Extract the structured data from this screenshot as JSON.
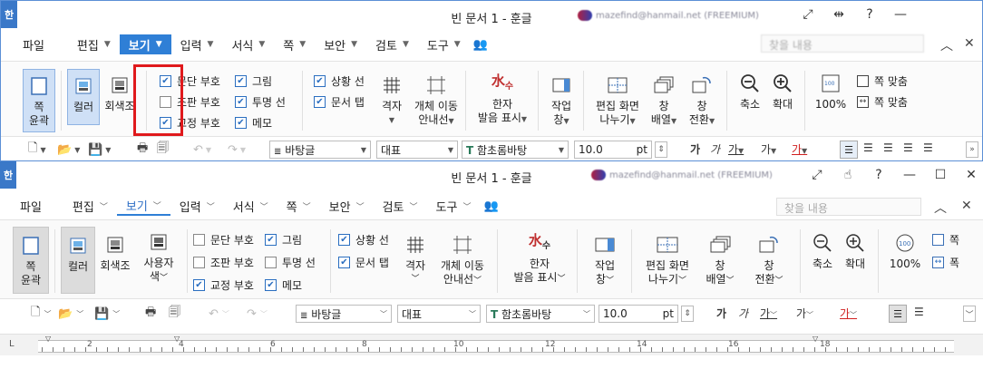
{
  "app": {
    "logo": "한",
    "title": "빈 문서 1 - 훈글",
    "account": "mazefind@hanmail.net (FREEMIUM)"
  },
  "menus": [
    {
      "label": "파일",
      "caret": false
    },
    {
      "label": "편집",
      "caret": true
    },
    {
      "label": "보기",
      "caret": true,
      "active": true
    },
    {
      "label": "입력",
      "caret": true
    },
    {
      "label": "서식",
      "caret": true
    },
    {
      "label": "쪽",
      "caret": true
    },
    {
      "label": "보안",
      "caret": true
    },
    {
      "label": "검토",
      "caret": true
    },
    {
      "label": "도구",
      "caret": true
    }
  ],
  "search": {
    "placeholder": "찾을 내용"
  },
  "ribbon": {
    "page_outline": {
      "line1": "쪽",
      "line2": "윤곽"
    },
    "color": "컬러",
    "grayscale": "회색조",
    "user_color": {
      "line1": "사용자",
      "line2": "색"
    },
    "checks": {
      "paragraph_mark": "문단 부호",
      "picture": "그림",
      "layout_mark": "조판 부호",
      "transparent_line": "투명 선",
      "proof_mark": "교정 부호",
      "memo": "메모",
      "status_line": "상황 선",
      "doc_tab": "문서 탭"
    },
    "grid": "격자",
    "obj_move": {
      "line1": "개체 이동",
      "line2": "안내선"
    },
    "hanja": {
      "line1": "한자",
      "line2": "발음 표시"
    },
    "task": {
      "line1": "작업",
      "line2": "창"
    },
    "split": {
      "line1": "편집 화면",
      "line2": "나누기"
    },
    "win_arrange": {
      "line1": "창",
      "line2": "배열"
    },
    "win_switch": {
      "line1": "창",
      "line2": "전환"
    },
    "zoom_out": "축소",
    "zoom_in": "확대",
    "zoom_100": "100%",
    "fit_page": "쪽 맞춤",
    "fit_width": "폭 맞춤",
    "fit_page_short": "쪽",
    "fit_width_short": "폭"
  },
  "toolbar": {
    "style": "바탕글",
    "lang": "대표",
    "font": "함초롬바탕",
    "size": "10.0",
    "unit": "pt"
  },
  "ruler": {
    "numbers": [
      "2",
      "4",
      "6",
      "8",
      "10",
      "12",
      "14",
      "16",
      "18"
    ],
    "marker": "L"
  }
}
